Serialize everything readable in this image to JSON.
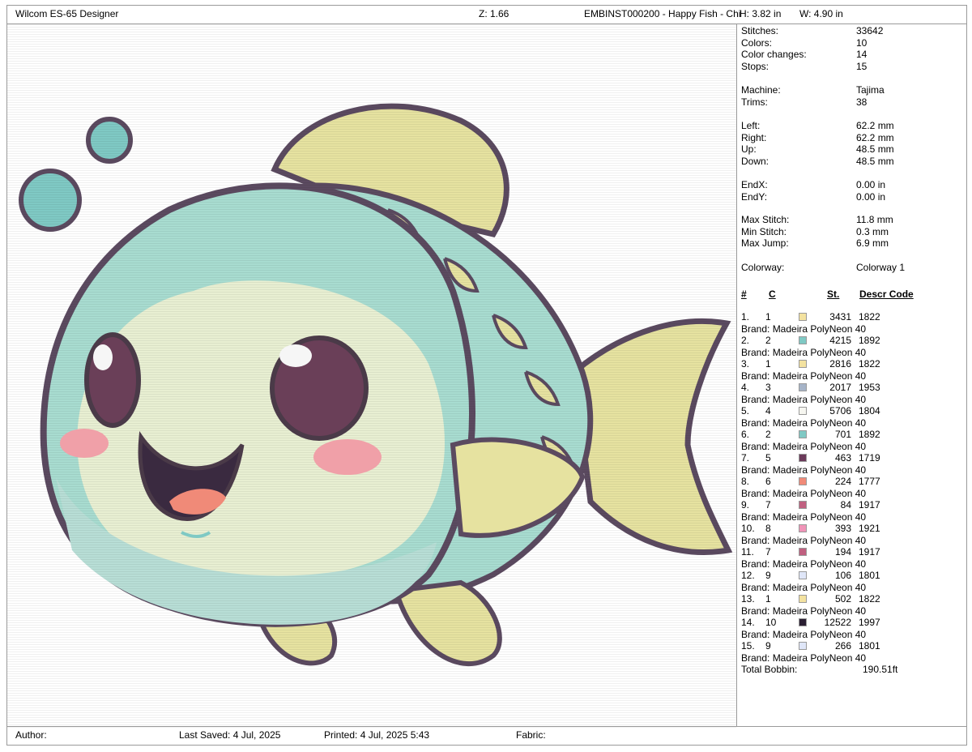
{
  "header": {
    "app_title": "Wilcom ES-65 Designer",
    "zoom": "Z: 1.66",
    "design_name": "EMBINST000200 - Happy Fish - Chi",
    "height": "H: 3.82 in",
    "width": "W: 4.90 in"
  },
  "footer": {
    "author_label": "Author:",
    "last_saved": "Last Saved:  4 Jul, 2025",
    "printed": "Printed:  4 Jul, 2025  5:43",
    "fabric_label": "Fabric:"
  },
  "stats": [
    {
      "label": "Stitches:",
      "value": "33642"
    },
    {
      "label": "Colors:",
      "value": "10"
    },
    {
      "label": "Color changes:",
      "value": "14"
    },
    {
      "label": "Stops:",
      "value": "15"
    },
    {
      "label": "Machine:",
      "value": "Tajima"
    },
    {
      "label": "Trims:",
      "value": "38"
    },
    {
      "label": "Left:",
      "value": "62.2 mm"
    },
    {
      "label": "Right:",
      "value": "62.2 mm"
    },
    {
      "label": "Up:",
      "value": "48.5 mm"
    },
    {
      "label": "Down:",
      "value": "48.5 mm"
    },
    {
      "label": "EndX:",
      "value": "0.00 in"
    },
    {
      "label": "EndY:",
      "value": "0.00 in"
    },
    {
      "label": "Max Stitch:",
      "value": "11.8 mm"
    },
    {
      "label": "Min Stitch:",
      "value": "0.3 mm"
    },
    {
      "label": "Max Jump:",
      "value": "6.9 mm"
    },
    {
      "label": "Colorway:",
      "value": "Colorway 1"
    }
  ],
  "table_headers": {
    "num": "#",
    "color": "C",
    "stitches": "St.",
    "descr_code": "Descr  Code"
  },
  "color_rows": [
    {
      "num": "1.",
      "c": "1",
      "color": "#f3e2a0",
      "st": "3431",
      "code": "1822",
      "brand": "Brand: Madeira PolyNeon 40"
    },
    {
      "num": "2.",
      "c": "2",
      "color": "#7fc9c4",
      "st": "4215",
      "code": "1892",
      "brand": "Brand: Madeira PolyNeon 40"
    },
    {
      "num": "3.",
      "c": "1",
      "color": "#f3e2a0",
      "st": "2816",
      "code": "1822",
      "brand": "Brand: Madeira PolyNeon 40"
    },
    {
      "num": "4.",
      "c": "3",
      "color": "#a6b4c8",
      "st": "2017",
      "code": "1953",
      "brand": "Brand: Madeira PolyNeon 40"
    },
    {
      "num": "5.",
      "c": "4",
      "color": "#f6f6f0",
      "st": "5706",
      "code": "1804",
      "brand": "Brand: Madeira PolyNeon 40"
    },
    {
      "num": "6.",
      "c": "2",
      "color": "#7fc9c4",
      "st": "701",
      "code": "1892",
      "brand": "Brand: Madeira PolyNeon 40"
    },
    {
      "num": "7.",
      "c": "5",
      "color": "#6b3a5a",
      "st": "463",
      "code": "1719",
      "brand": "Brand: Madeira PolyNeon 40"
    },
    {
      "num": "8.",
      "c": "6",
      "color": "#f08a78",
      "st": "224",
      "code": "1777",
      "brand": "Brand: Madeira PolyNeon 40"
    },
    {
      "num": "9.",
      "c": "7",
      "color": "#c06080",
      "st": "84",
      "code": "1917",
      "brand": "Brand: Madeira PolyNeon 40"
    },
    {
      "num": "10.",
      "c": "8",
      "color": "#f094b8",
      "st": "393",
      "code": "1921",
      "brand": "Brand: Madeira PolyNeon 40"
    },
    {
      "num": "11.",
      "c": "7",
      "color": "#c06080",
      "st": "194",
      "code": "1917",
      "brand": "Brand: Madeira PolyNeon 40"
    },
    {
      "num": "12.",
      "c": "9",
      "color": "#dfe6f8",
      "st": "106",
      "code": "1801",
      "brand": "Brand: Madeira PolyNeon 40"
    },
    {
      "num": "13.",
      "c": "1",
      "color": "#f3e2a0",
      "st": "502",
      "code": "1822",
      "brand": "Brand: Madeira PolyNeon 40"
    },
    {
      "num": "14.",
      "c": "10",
      "color": "#2a1e32",
      "st": "12522",
      "code": "1997",
      "brand": "Brand: Madeira PolyNeon 40"
    },
    {
      "num": "15.",
      "c": "9",
      "color": "#dfe6f8",
      "st": "266",
      "code": "1801",
      "brand": "Brand: Madeira PolyNeon 40"
    }
  ],
  "total_bobbin": {
    "label": "Total Bobbin:",
    "value": "190.51ft"
  },
  "design_colors": {
    "outline": "#5b4a60",
    "body_green": "#a8dcd0",
    "belly": "#e8efd2",
    "fin_yellow": "#e6e2a0",
    "blush": "#f0a0a8",
    "eye": "#6a3f58",
    "bubble": "#7fc9c4"
  }
}
